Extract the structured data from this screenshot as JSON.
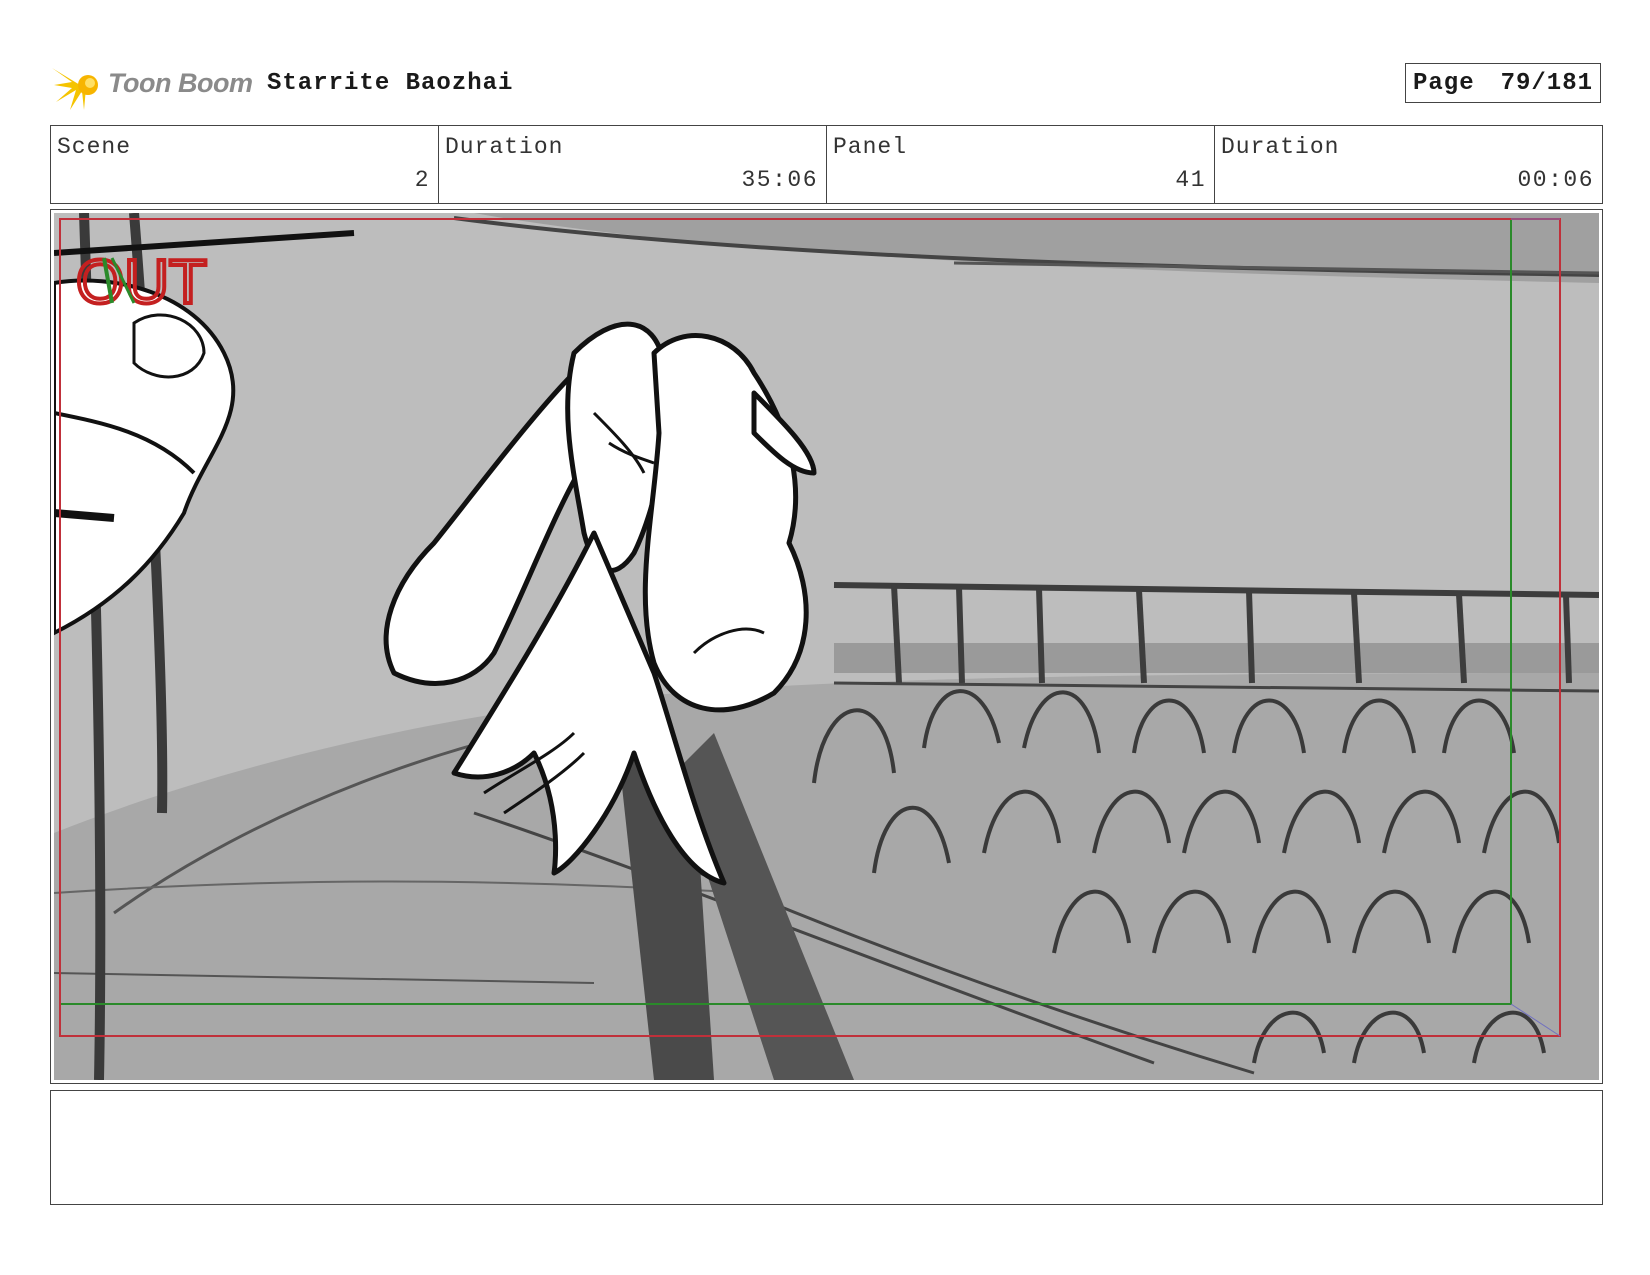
{
  "header": {
    "logo_text": "Toon Boom",
    "project_title": "Starrite Baozhai",
    "page_label": "Page",
    "page_value": "79/181"
  },
  "info": {
    "scene_label": "Scene",
    "scene_value": "2",
    "scene_duration_label": "Duration",
    "scene_duration_value": "35:06",
    "panel_label": "Panel",
    "panel_value": "41",
    "panel_duration_label": "Duration",
    "panel_duration_value": "00:06"
  },
  "panel": {
    "out_marker": "OUT"
  },
  "notes": {
    "text": ""
  },
  "colors": {
    "safe_frame": "#c0303a",
    "title_safe": "#2a8a2a",
    "out_text": "#c42020",
    "sketch_bg": "#bdbdbd",
    "sketch_dark": "#9a9a9a"
  }
}
